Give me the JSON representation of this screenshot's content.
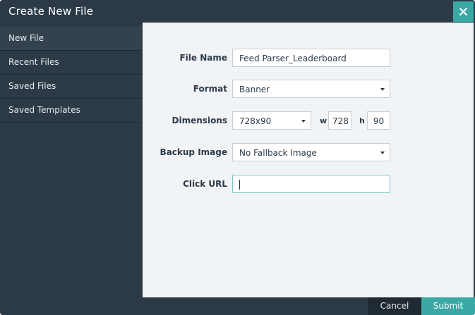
{
  "dialog": {
    "title": "Create New File",
    "close_icon": "close-icon"
  },
  "sidebar": {
    "items": [
      {
        "label": "New File",
        "active": true
      },
      {
        "label": "Recent Files",
        "active": false
      },
      {
        "label": "Saved Files",
        "active": false
      },
      {
        "label": "Saved Templates",
        "active": false
      }
    ]
  },
  "form": {
    "file_name": {
      "label": "File Name",
      "value": "Feed Parser_Leaderboard"
    },
    "format": {
      "label": "Format",
      "value": "Banner"
    },
    "dimensions": {
      "label": "Dimensions",
      "preset": "728x90",
      "w_label": "w",
      "width": "728",
      "h_label": "h",
      "height": "90"
    },
    "backup_image": {
      "label": "Backup Image",
      "value": "No Fallback Image"
    },
    "click_url": {
      "label": "Click URL",
      "value": ""
    }
  },
  "footer": {
    "cancel_label": "Cancel",
    "submit_label": "Submit"
  },
  "colors": {
    "accent": "#3aa8a5",
    "dark": "#2c3a47",
    "panel": "#f1f4f6"
  }
}
